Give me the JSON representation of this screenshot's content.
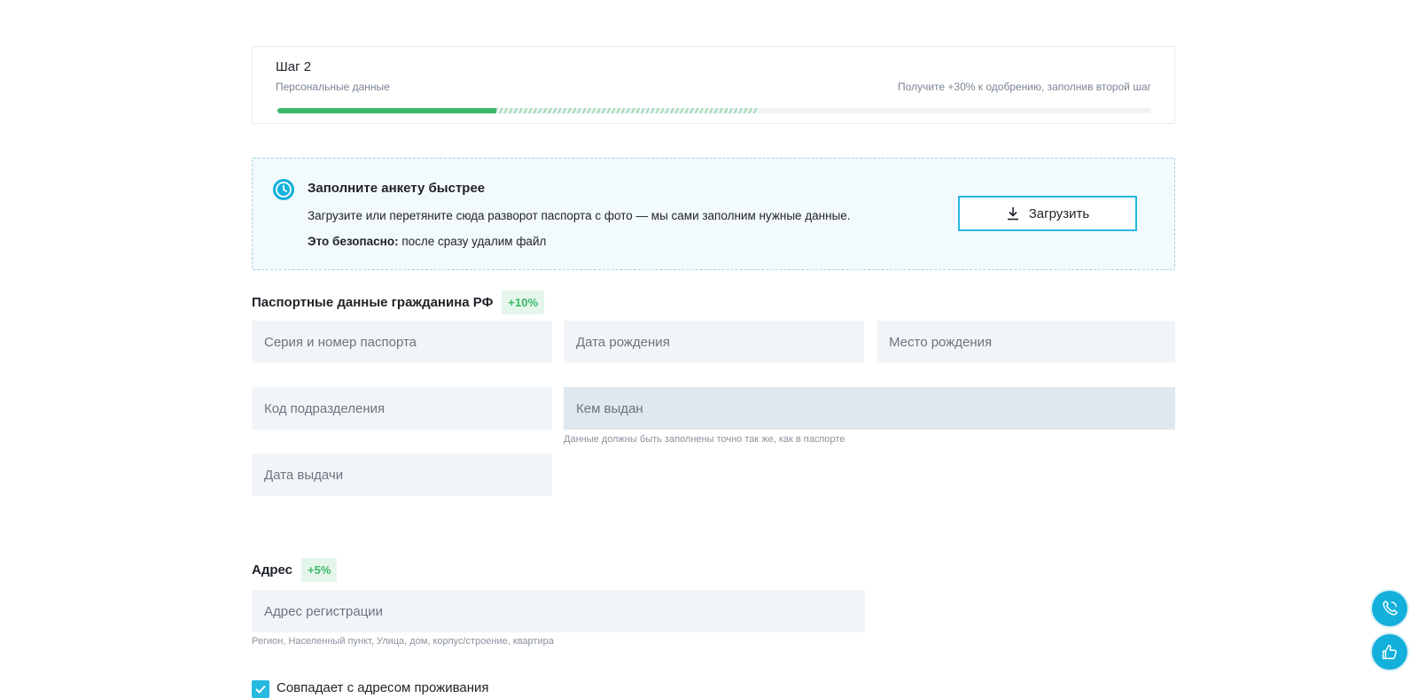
{
  "step": {
    "title": "Шаг 2",
    "subtitle": "Персональные данные",
    "hint": "Получите +30% к одобрению, заполнив второй шаг",
    "progress_filled": 0.25,
    "progress_potential_end": 0.55,
    "colors": {
      "filled": "#3cb86b",
      "potential": "#9fdcb6",
      "track": "#f1f3f5"
    }
  },
  "upload": {
    "icon": "clock-icon",
    "title": "Заполните анкету быстрее",
    "description": "Загрузите или перетяните сюда разворот паспорта с фото — мы сами заполним нужные данные.",
    "safe_bold": "Это безопасно:",
    "safe_rest": " после сразу удалим файл",
    "button_icon": "download-icon",
    "button_label": "Загрузить"
  },
  "passport": {
    "title": "Паспортные данные гражданина РФ",
    "badge": "+10%",
    "fields": {
      "series_number": {
        "placeholder": "Серия и номер паспорта",
        "value": ""
      },
      "birth_date": {
        "placeholder": "Дата рождения",
        "value": ""
      },
      "birth_place": {
        "placeholder": "Место рождения",
        "value": ""
      },
      "department_code": {
        "placeholder": "Код подразделения",
        "value": ""
      },
      "issued_by": {
        "placeholder": "Кем выдан",
        "value": "",
        "helper": "Данные должны быть заполнены точно так же, как в паспорте"
      },
      "issue_date": {
        "placeholder": "Дата выдачи",
        "value": ""
      }
    }
  },
  "address": {
    "title": "Адрес",
    "badge": "+5%",
    "registration": {
      "placeholder": "Адрес регистрации",
      "value": "",
      "helper": "Регион, Населенный пункт, Улица, дом, корпус/строение, квартира"
    },
    "same_as_residence": {
      "label": "Совпадает с адресом проживания",
      "checked": true
    }
  },
  "floating": {
    "phone_icon": "phone-icon",
    "feedback_icon": "thumbs-up-icon",
    "accent": "#12b0db"
  }
}
